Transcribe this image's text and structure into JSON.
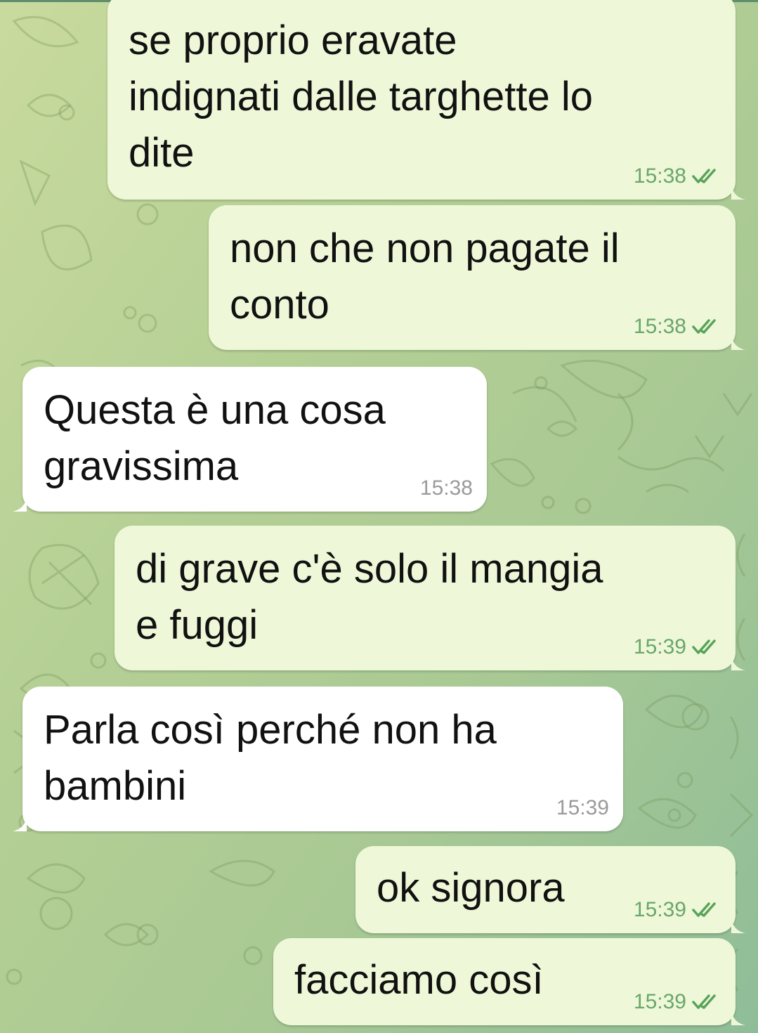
{
  "colors": {
    "outgoing_bubble": "#eef8d8",
    "incoming_bubble": "#ffffff",
    "check": "#5aa35a",
    "timestamp_out": "#6aa66a",
    "timestamp_in": "#9a9a9a"
  },
  "messages": [
    {
      "direction": "outgoing",
      "text": "se proprio eravate\nindignati dalle targhette lo\ndite",
      "time": "15:38",
      "status": "read",
      "status_icon": "double-check-icon"
    },
    {
      "direction": "outgoing",
      "text": "non che non pagate il\nconto",
      "time": "15:38",
      "status": "read",
      "status_icon": "double-check-icon"
    },
    {
      "direction": "incoming",
      "text": "Questa è una cosa\ngravissima",
      "time": "15:38"
    },
    {
      "direction": "outgoing",
      "text": "di grave c'è solo il mangia\ne fuggi",
      "time": "15:39",
      "status": "read",
      "status_icon": "double-check-icon"
    },
    {
      "direction": "incoming",
      "text": "Parla così perché non ha\nbambini",
      "time": "15:39"
    },
    {
      "direction": "outgoing",
      "text": "ok signora",
      "time": "15:39",
      "status": "read",
      "status_icon": "double-check-icon"
    },
    {
      "direction": "outgoing",
      "text": "facciamo così",
      "time": "15:39",
      "status": "read",
      "status_icon": "double-check-icon"
    }
  ]
}
